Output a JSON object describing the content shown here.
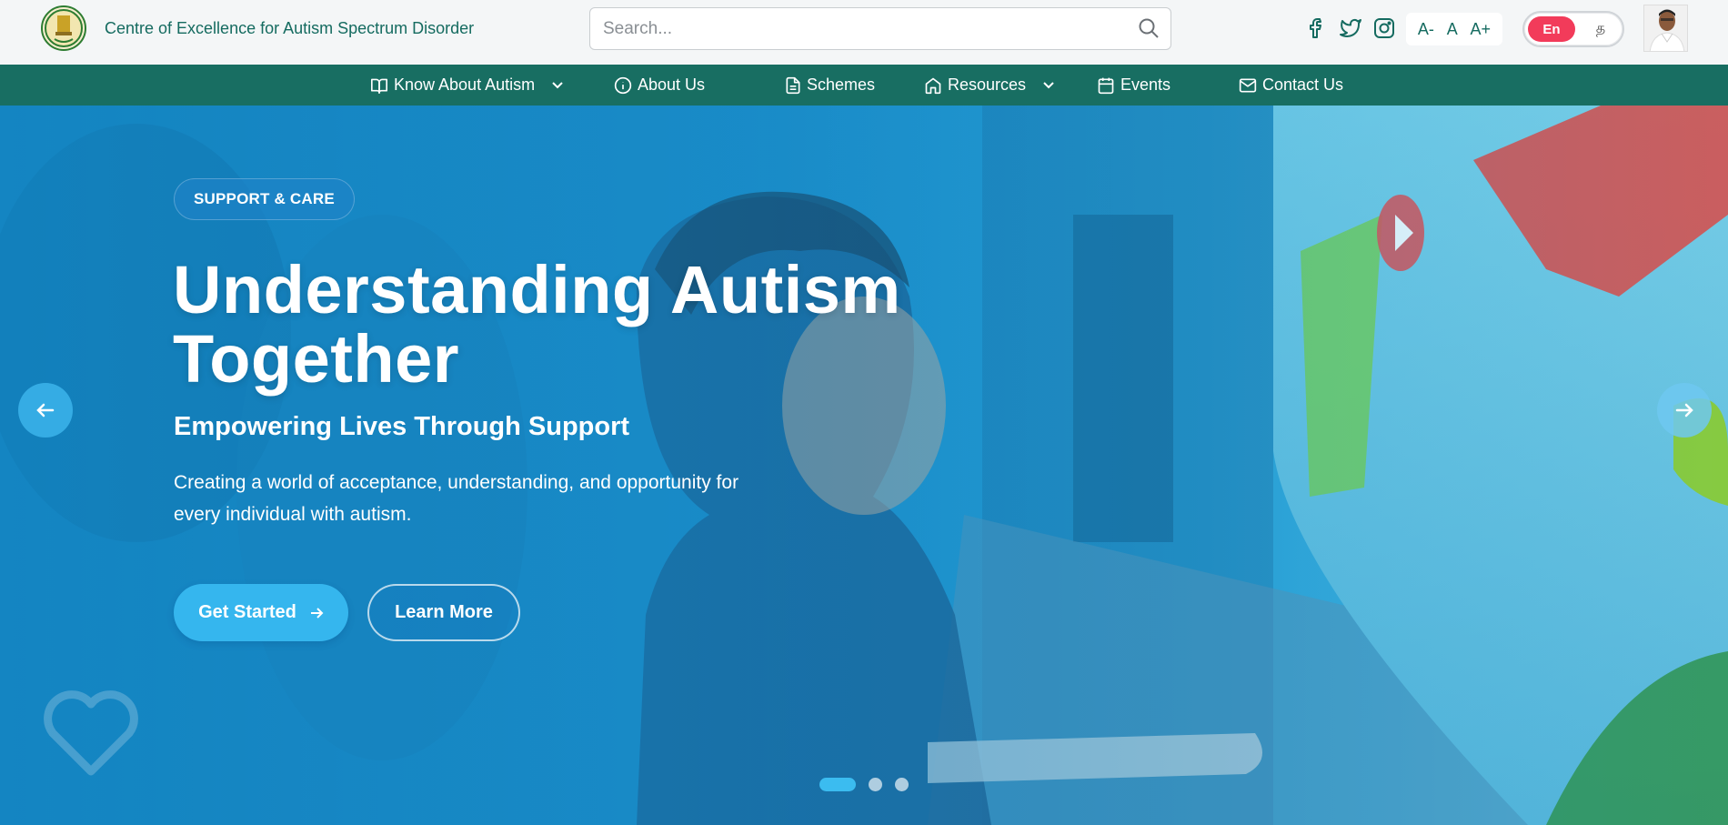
{
  "header": {
    "brand_title": "Centre of Excellence for Autism Spectrum Disorder",
    "search_placeholder": "Search...",
    "socials": [
      "facebook-icon",
      "twitter-icon",
      "instagram-icon"
    ],
    "font_controls": {
      "decrease": "A-",
      "normal": "A",
      "increase": "A+"
    },
    "language": {
      "english": "En",
      "tamil": "த",
      "active": "En"
    }
  },
  "nav": {
    "items": [
      {
        "label": "Know About Autism",
        "icon": "book-icon",
        "has_dropdown": true
      },
      {
        "label": "About Us",
        "icon": "info-icon",
        "has_dropdown": false
      },
      {
        "label": "Schemes",
        "icon": "document-icon",
        "has_dropdown": false
      },
      {
        "label": "Resources",
        "icon": "home-icon",
        "has_dropdown": true
      },
      {
        "label": "Events",
        "icon": "calendar-icon",
        "has_dropdown": false
      },
      {
        "label": "Contact Us",
        "icon": "mail-icon",
        "has_dropdown": false
      }
    ]
  },
  "hero": {
    "badge": "SUPPORT & CARE",
    "headline_line1": "Understanding Autism",
    "headline_line2": "Together",
    "subheading": "Empowering Lives Through Support",
    "description_line1": "Creating a world of acceptance, understanding, and opportunity for",
    "description_line2": "every individual with autism.",
    "primary_cta": "Get Started",
    "secondary_cta": "Learn More",
    "slide_count": 3,
    "active_slide": 1
  },
  "colors": {
    "brand_green": "#186e62",
    "accent_blue": "#35b6ee",
    "language_active": "#f23b5a"
  }
}
